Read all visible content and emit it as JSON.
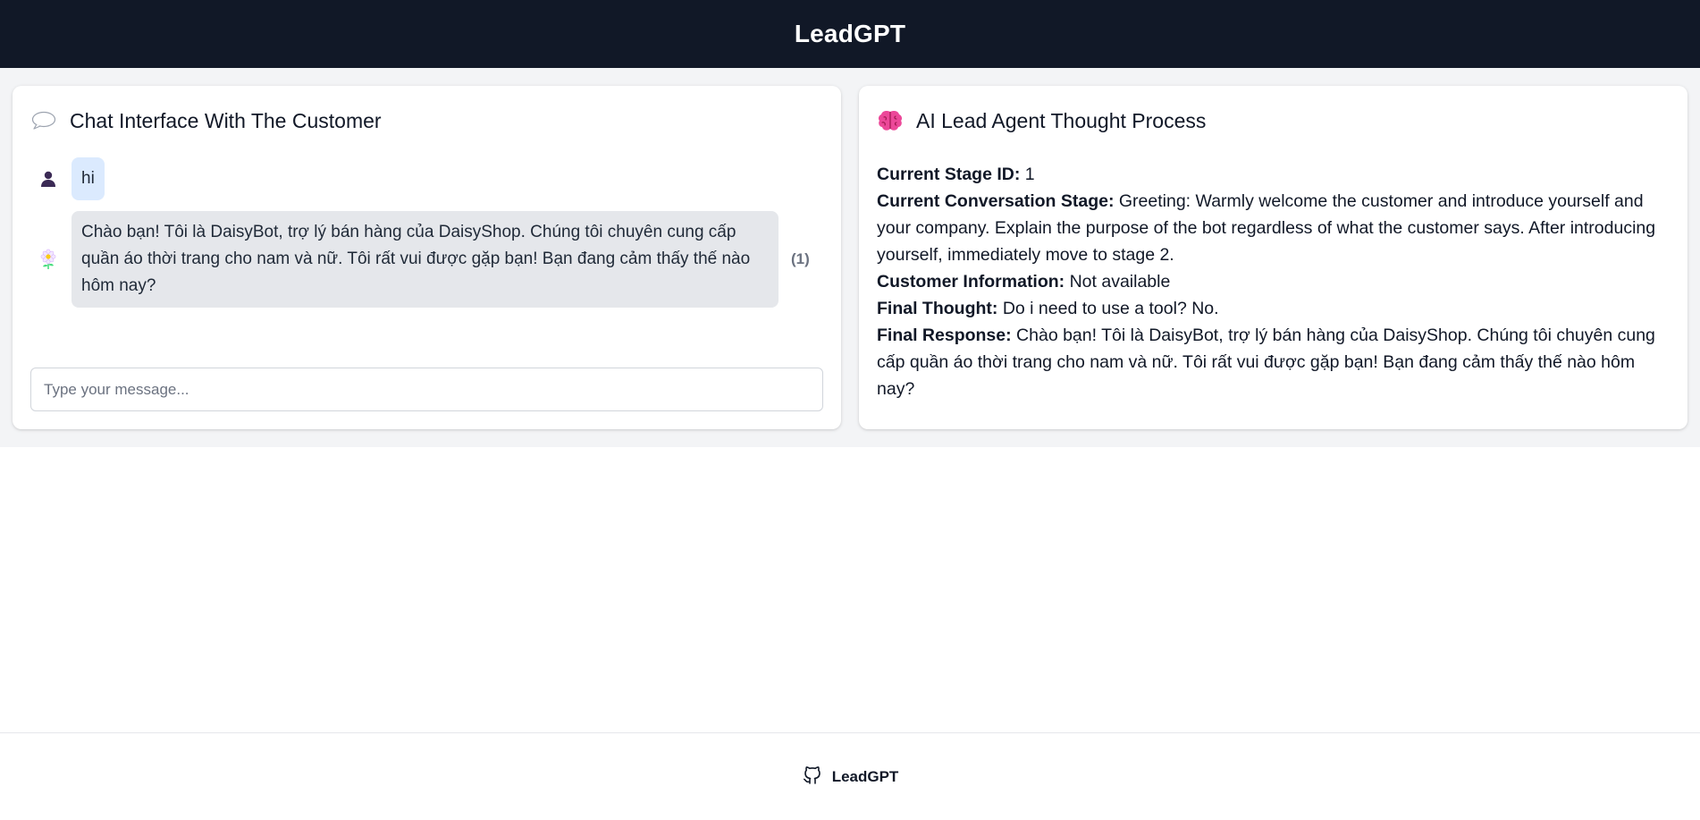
{
  "header": {
    "title": "LeadGPT"
  },
  "chat_panel": {
    "title": "Chat Interface With The Customer",
    "icon": "speech-bubble-icon",
    "messages": [
      {
        "role": "user",
        "avatar": "user-avatar-icon",
        "text": "hi"
      },
      {
        "role": "bot",
        "avatar": "flower-bot-icon",
        "text": "Chào bạn! Tôi là DaisyBot, trợ lý bán hàng của DaisyShop. Chúng tôi chuyên cung cấp quần áo thời trang cho nam và nữ. Tôi rất vui được gặp bạn! Bạn đang cảm thấy thế nào hôm nay?",
        "count": "(1)"
      }
    ],
    "input": {
      "placeholder": "Type your message...",
      "value": ""
    }
  },
  "thought_panel": {
    "title": "AI Lead Agent Thought Process",
    "icon": "brain-icon",
    "fields": [
      {
        "label": "Current Stage ID:",
        "value": "1"
      },
      {
        "label": "Current Conversation Stage:",
        "value": "Greeting: Warmly welcome the customer and introduce yourself and your company. Explain the purpose of the bot regardless of what the customer says. After introducing yourself, immediately move to stage 2."
      },
      {
        "label": "Customer Information:",
        "value": "Not available"
      },
      {
        "label": "Final Thought:",
        "value": "Do i need to use a tool? No."
      },
      {
        "label": "Final Response:",
        "value": "Chào bạn! Tôi là DaisyBot, trợ lý bán hàng của DaisyShop. Chúng tôi chuyên cung cấp quần áo thời trang cho nam và nữ. Tôi rất vui được gặp bạn! Bạn đang cảm thấy thế nào hôm nay?"
      }
    ]
  },
  "footer": {
    "label": "LeadGPT",
    "icon": "github-icon"
  },
  "colors": {
    "header_bg": "#111827",
    "page_bg": "#f3f4f6",
    "user_bubble": "#dbeafe",
    "bot_bubble": "#e5e7eb"
  }
}
